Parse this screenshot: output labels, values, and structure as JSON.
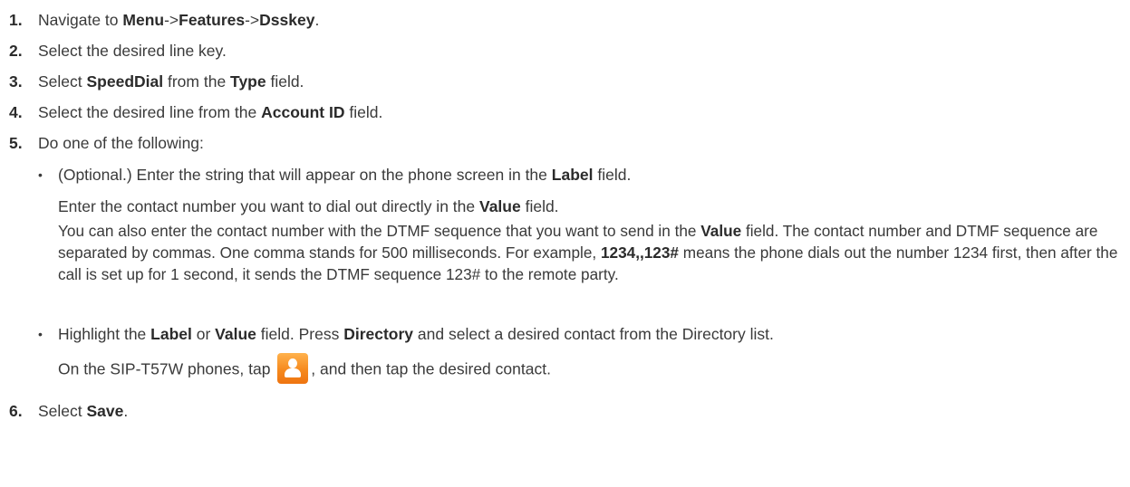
{
  "steps": [
    {
      "num": "1.",
      "p1": "Navigate to ",
      "b1": "Menu",
      "p2": "->",
      "b2": "Features",
      "p3": "->",
      "b3": "Dsskey",
      "p4": "."
    },
    {
      "num": "2.",
      "p1": "Select the desired line key."
    },
    {
      "num": "3.",
      "p1": "Select ",
      "b1": "SpeedDial",
      "p2": " from the ",
      "b2": "Type",
      "p3": " field."
    },
    {
      "num": "4.",
      "p1": "Select the desired line from the ",
      "b1": "Account ID",
      "p2": " field."
    },
    {
      "num": "5.",
      "p1": "Do one of the following:"
    },
    {
      "num": "6.",
      "p1": "Select ",
      "b1": "Save",
      "p2": "."
    }
  ],
  "option1": {
    "bullet": "•",
    "l1_p1": "(Optional.) Enter the string that will appear on the phone screen in the ",
    "l1_b1": "Label",
    "l1_p2": " field.",
    "l2_p1": "Enter the contact number you want to dial out directly in the ",
    "l2_b1": "Value",
    "l2_p2": " field.",
    "l3_p1": "You can also enter the contact number with the DTMF sequence that you want to send in the ",
    "l3_b1": "Value",
    "l3_p2": " field. The contact number and DTMF sequence are separated by commas. One comma stands for 500 milliseconds. For example, ",
    "l3_b2": "1234,,123#",
    "l3_p3": " means the phone dials out the number 1234 first, then after the call is set up for 1 second, it sends the DTMF sequence 123# to the remote party."
  },
  "option2": {
    "bullet": "•",
    "l1_p1": "Highlight the ",
    "l1_b1": "Label",
    "l1_p2": " or ",
    "l1_b2": "Value",
    "l1_p3": " field. Press ",
    "l1_b3": "Directory",
    "l1_p4": " and select a desired contact from the Directory list.",
    "l2_p1": "On the SIP-T57W phones, tap ",
    "l2_icon": "contact-directory-icon",
    "l2_p2": ", and then tap the desired contact."
  }
}
